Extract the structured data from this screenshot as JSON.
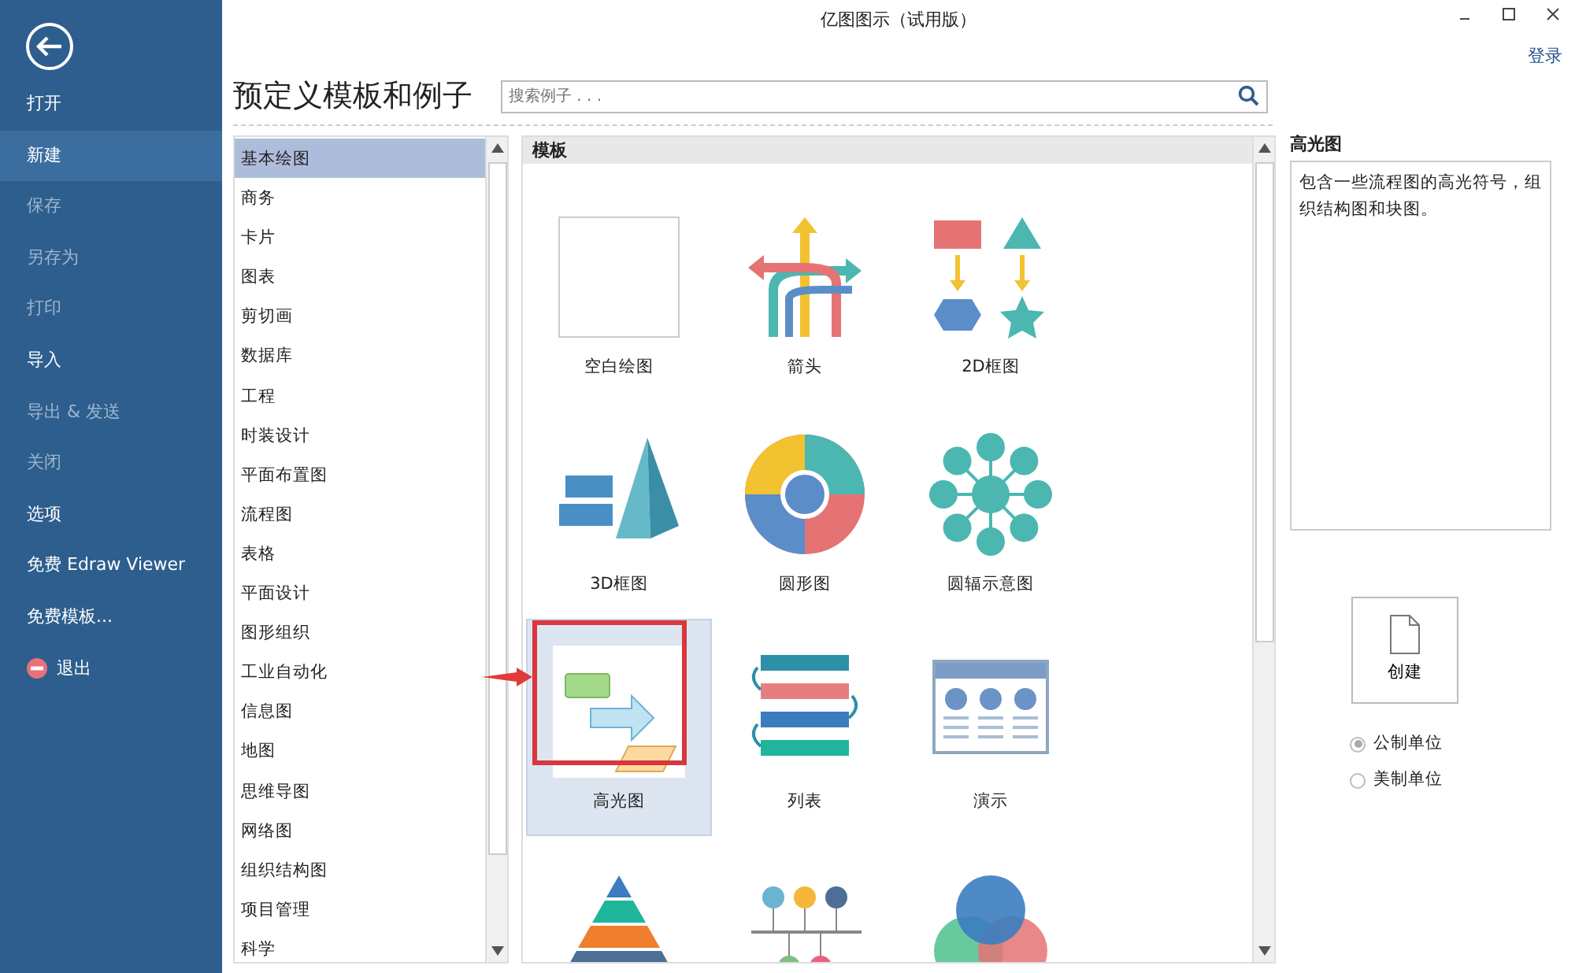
{
  "window": {
    "title": "亿图图示（试用版）",
    "login": "登录"
  },
  "sidebar": {
    "items": [
      {
        "label": "打开",
        "selected": false,
        "disabled": false
      },
      {
        "label": "新建",
        "selected": true,
        "disabled": false
      },
      {
        "label": "保存",
        "selected": false,
        "disabled": true
      },
      {
        "label": "另存为",
        "selected": false,
        "disabled": true
      },
      {
        "label": "打印",
        "selected": false,
        "disabled": true
      },
      {
        "label": "导入",
        "selected": false,
        "disabled": false
      },
      {
        "label": "导出 & 发送",
        "selected": false,
        "disabled": true
      },
      {
        "label": "关闭",
        "selected": false,
        "disabled": true
      },
      {
        "label": "选项",
        "selected": false,
        "disabled": false
      },
      {
        "label": "免费 Edraw Viewer",
        "selected": false,
        "disabled": false
      },
      {
        "label": "免费模板...",
        "selected": false,
        "disabled": false
      },
      {
        "label": "退出",
        "selected": false,
        "disabled": false,
        "kind": "exit"
      }
    ]
  },
  "heading": "预定义模板和例子",
  "search": {
    "placeholder": "搜索例子 . . ."
  },
  "categories": [
    {
      "label": "基本绘图",
      "selected": true
    },
    {
      "label": "商务",
      "selected": false
    },
    {
      "label": "卡片",
      "selected": false
    },
    {
      "label": "图表",
      "selected": false
    },
    {
      "label": "剪切画",
      "selected": false
    },
    {
      "label": "数据库",
      "selected": false
    },
    {
      "label": "工程",
      "selected": false
    },
    {
      "label": "时装设计",
      "selected": false
    },
    {
      "label": "平面布置图",
      "selected": false
    },
    {
      "label": "流程图",
      "selected": false
    },
    {
      "label": "表格",
      "selected": false
    },
    {
      "label": "平面设计",
      "selected": false
    },
    {
      "label": "图形组织",
      "selected": false
    },
    {
      "label": "工业自动化",
      "selected": false
    },
    {
      "label": "信息图",
      "selected": false
    },
    {
      "label": "地图",
      "selected": false
    },
    {
      "label": "思维导图",
      "selected": false
    },
    {
      "label": "网络图",
      "selected": false
    },
    {
      "label": "组织结构图",
      "selected": false
    },
    {
      "label": "项目管理",
      "selected": false
    },
    {
      "label": "科学",
      "selected": false
    }
  ],
  "templates": {
    "header": "模板",
    "items": [
      {
        "label": "空白绘图",
        "kind": "blank",
        "selected": false
      },
      {
        "label": "箭头",
        "kind": "arrows",
        "selected": false
      },
      {
        "label": "2D框图",
        "kind": "blocks2d",
        "selected": false
      },
      {
        "label": "3D框图",
        "kind": "blocks3d",
        "selected": false
      },
      {
        "label": "圆形图",
        "kind": "circular",
        "selected": false
      },
      {
        "label": "圆辐示意图",
        "kind": "radial",
        "selected": false
      },
      {
        "label": "高光图",
        "kind": "highlight",
        "selected": true,
        "annotated": true
      },
      {
        "label": "列表",
        "kind": "list",
        "selected": false
      },
      {
        "label": "演示",
        "kind": "presentation",
        "selected": false
      },
      {
        "kind": "pyramid",
        "selected": false
      },
      {
        "kind": "timeline",
        "selected": false
      },
      {
        "kind": "venn",
        "selected": false
      }
    ]
  },
  "details": {
    "title": "高光图",
    "description": "包含一些流程图的高光符号，组织结构图和块图。",
    "create": "创建",
    "units": [
      {
        "label": "公制单位",
        "selected": true
      },
      {
        "label": "美制单位",
        "selected": false
      }
    ]
  }
}
